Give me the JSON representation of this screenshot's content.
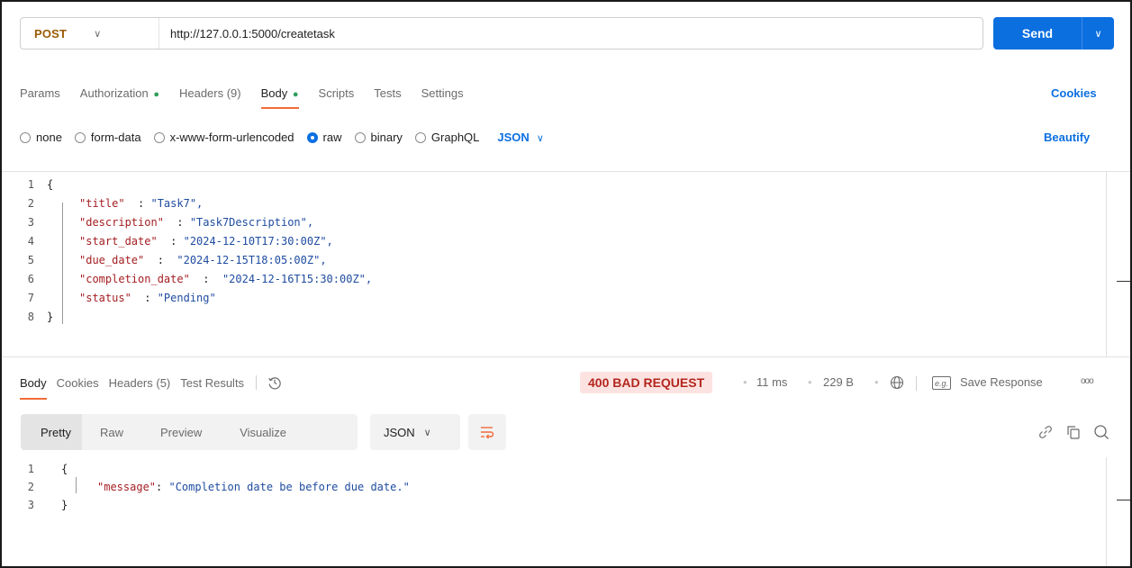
{
  "request": {
    "method": "POST",
    "url": "http://127.0.0.1:5000/createtask",
    "send_label": "Send"
  },
  "request_tabs": [
    {
      "label": "Params"
    },
    {
      "label": "Authorization",
      "dot": "●"
    },
    {
      "label": "Headers (9)"
    },
    {
      "label": "Body",
      "dot": "●",
      "active": true
    },
    {
      "label": "Scripts"
    },
    {
      "label": "Tests"
    },
    {
      "label": "Settings"
    }
  ],
  "cookies_label": "Cookies",
  "body_types": [
    {
      "label": "none"
    },
    {
      "label": "form-data"
    },
    {
      "label": "x-www-form-urlencoded"
    },
    {
      "label": "raw",
      "selected": true
    },
    {
      "label": "binary"
    },
    {
      "label": "GraphQL"
    }
  ],
  "body_format": "JSON",
  "beautify_label": "Beautify",
  "request_body": {
    "line_numbers": [
      "1",
      "2",
      "3",
      "4",
      "5",
      "6",
      "7",
      "8"
    ],
    "open_brace": "{",
    "close_brace": "}",
    "fields": [
      {
        "key": "\"title\"",
        "sep": "  : ",
        "value": "\"Task7\","
      },
      {
        "key": "\"description\"",
        "sep": "  : ",
        "value": "\"Task7Description\","
      },
      {
        "key": "\"start_date\"",
        "sep": "  : ",
        "value": "\"2024-12-10T17:30:00Z\","
      },
      {
        "key": "\"due_date\"",
        "sep": "  :  ",
        "value": "\"2024-12-15T18:05:00Z\","
      },
      {
        "key": "\"completion_date\"",
        "sep": "  :  ",
        "value": "\"2024-12-16T15:30:00Z\","
      },
      {
        "key": "\"status\"",
        "sep": "  : ",
        "value": "\"Pending\""
      }
    ]
  },
  "response_tabs": [
    {
      "label": "Body",
      "active": true
    },
    {
      "label": "Cookies"
    },
    {
      "label": "Headers (5)"
    },
    {
      "label": "Test Results"
    }
  ],
  "response_status": {
    "status": "400 BAD REQUEST",
    "time": "11 ms",
    "size": "229 B",
    "save_label": "Save Response",
    "eg_label": "e.g.",
    "more_label": "ooo"
  },
  "response_view": {
    "tabs": [
      "Pretty",
      "Raw",
      "Preview",
      "Visualize"
    ],
    "format": "JSON"
  },
  "response_body": {
    "line_numbers": [
      "1",
      "2",
      "3"
    ],
    "open_brace": "{",
    "close_brace": "}",
    "key": "\"message\"",
    "sep": ": ",
    "value": "\"Completion date be before due date.\""
  },
  "colors": {
    "accent": "#0c6fe0",
    "method": "#9a5b05",
    "active_tab": "#f26b3a",
    "error_bg": "#fce3e1",
    "error_text": "#b3261e",
    "json_key": "#a41e22",
    "json_string": "#1f4ca0"
  },
  "icons": [
    "chevron-down-icon",
    "history-icon",
    "globe-icon",
    "example-icon",
    "more-icon",
    "wrap-icon",
    "link-icon",
    "copy-icon",
    "search-icon"
  ]
}
